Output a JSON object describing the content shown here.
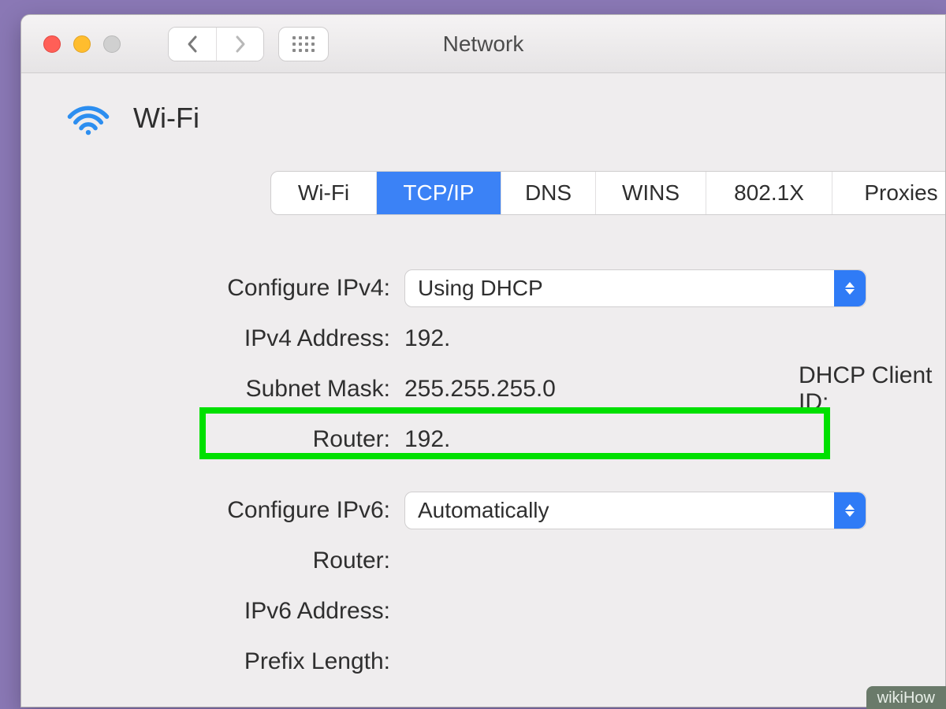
{
  "titlebar": {
    "window_title": "Network"
  },
  "header": {
    "icon": "wifi-icon",
    "title": "Wi-Fi"
  },
  "tabs": [
    {
      "id": "wifi",
      "label": "Wi-Fi",
      "active": false
    },
    {
      "id": "tcpip",
      "label": "TCP/IP",
      "active": true
    },
    {
      "id": "dns",
      "label": "DNS",
      "active": false
    },
    {
      "id": "wins",
      "label": "WINS",
      "active": false
    },
    {
      "id": "8021x",
      "label": "802.1X",
      "active": false
    },
    {
      "id": "prox",
      "label": "Proxies",
      "active": false
    }
  ],
  "ipv4": {
    "configure_label": "Configure IPv4:",
    "configure_value": "Using DHCP",
    "address_label": "IPv4 Address:",
    "address_value": "192.",
    "subnet_label": "Subnet Mask:",
    "subnet_value": "255.255.255.0",
    "router_label": "Router:",
    "router_value": "192.",
    "dhcp_client_id_label": "DHCP Client ID:"
  },
  "ipv6": {
    "configure_label": "Configure IPv6:",
    "configure_value": "Automatically",
    "router_label": "Router:",
    "router_value": "",
    "address_label": "IPv6 Address:",
    "address_value": "",
    "prefix_label": "Prefix Length:",
    "prefix_value": ""
  },
  "annotation": {
    "highlight_row": "ipv4.router",
    "watermark": "wikiHow"
  },
  "colors": {
    "desktop": "#8a78b5",
    "accent": "#3b82f6",
    "highlight": "#00e000"
  }
}
